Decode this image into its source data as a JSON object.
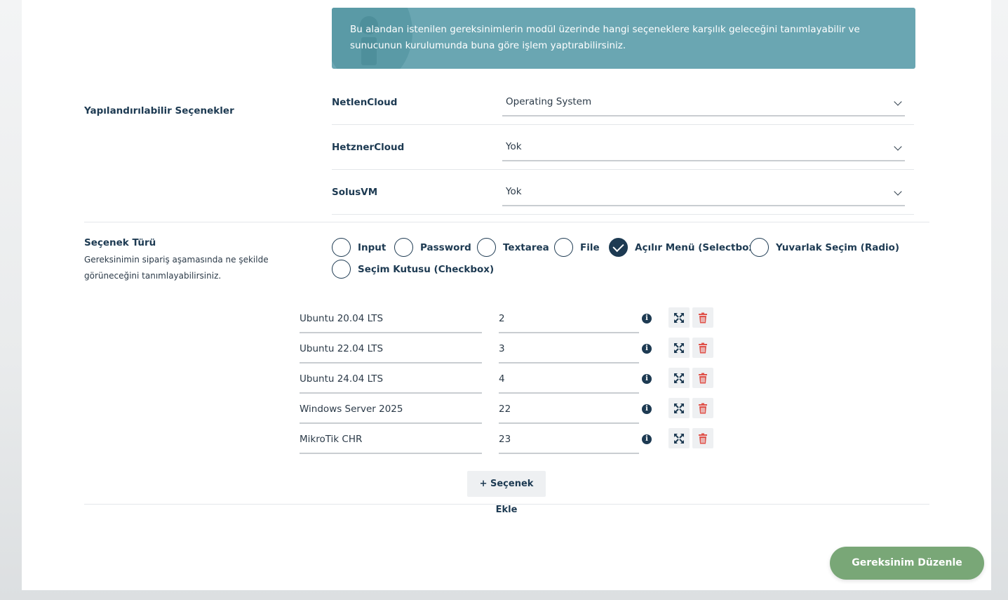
{
  "info_box": {
    "text": "Bu alandan istenilen gereksinimlerin modül üzerinde hangi seçeneklere karşılık geleceğini tanımlayabilir ve sunucunun kurulumunda buna göre işlem yaptırabilirsiniz."
  },
  "configurable": {
    "label": "Yapılandırılabilir Seçenekler",
    "rows": [
      {
        "module": "NetlenCloud",
        "value": "Operating System"
      },
      {
        "module": "HetznerCloud",
        "value": "Yok"
      },
      {
        "module": "SolusVM",
        "value": "Yok"
      }
    ]
  },
  "option_type": {
    "label": "Seçenek Türü",
    "description": "Gereksinimin sipariş aşamasında ne şekilde görüneceğini tanımlayabilirsiniz.",
    "radios": [
      {
        "label": "Input",
        "checked": false
      },
      {
        "label": "Password",
        "checked": false
      },
      {
        "label": "Textarea",
        "checked": false
      },
      {
        "label": "File",
        "checked": false
      },
      {
        "label": "Açılır Menü (Selectbox)",
        "checked": true
      },
      {
        "label": "Yuvarlak Seçim (Radio)",
        "checked": false
      },
      {
        "label": "Seçim Kutusu (Checkbox)",
        "checked": false
      }
    ]
  },
  "options": [
    {
      "name": "Ubuntu 20.04 LTS",
      "value": "2"
    },
    {
      "name": "Ubuntu 22.04 LTS",
      "value": "3"
    },
    {
      "name": "Ubuntu 24.04 LTS",
      "value": "4"
    },
    {
      "name": "Windows Server 2025",
      "value": "22"
    },
    {
      "name": "MikroTik CHR",
      "value": "23"
    }
  ],
  "buttons": {
    "add_option": "+ Seçenek Ekle",
    "submit": "Gereksinim Düzenle"
  },
  "colors": {
    "info_bg": "#6aa6b2",
    "primary_text": "#1d3a52",
    "submit_bg": "#79a777",
    "delete_icon": "#e0524a"
  }
}
